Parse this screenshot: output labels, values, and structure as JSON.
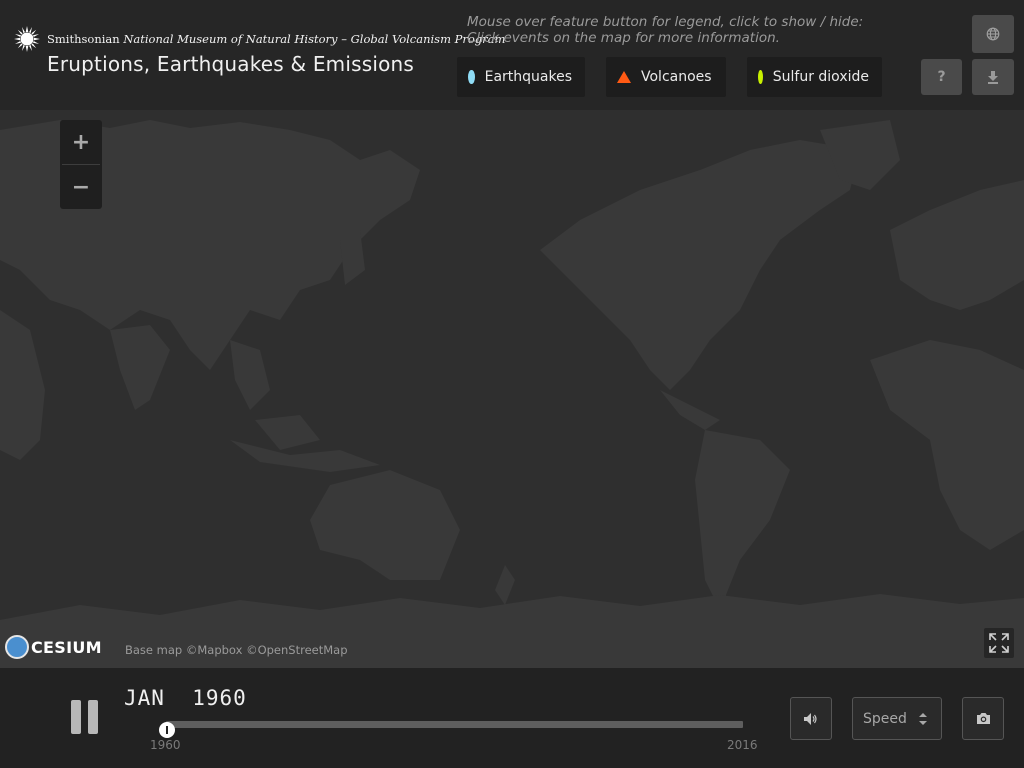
{
  "header": {
    "institution": "Smithsonian",
    "subtitle": "National Museum of Natural History – Global Volcanism Program",
    "title": "Eruptions, Earthquakes & Emissions",
    "hint_line1": "Mouse over feature button for legend, click to show / hide:",
    "hint_line2": "Click events on the map for more information."
  },
  "legend": [
    {
      "label": "Earthquakes",
      "symbol": "circle",
      "color": "#8fdcf5"
    },
    {
      "label": "Volcanoes",
      "symbol": "triangle",
      "color": "#ff5a14"
    },
    {
      "label": "Sulfur dioxide",
      "symbol": "circle",
      "color": "#c8f000"
    }
  ],
  "header_buttons": {
    "help_label": "?",
    "globe_icon": "globe-icon",
    "download_icon": "download-icon"
  },
  "map": {
    "zoom_in": "+",
    "zoom_out": "−",
    "cesium_word": "CESIUM",
    "attribution": "Base map ©Mapbox ©OpenStreetMap"
  },
  "timeline": {
    "date": "JAN  1960",
    "start_year": "1960",
    "end_year": "2016",
    "progress": 0,
    "speed_label": "Speed"
  }
}
